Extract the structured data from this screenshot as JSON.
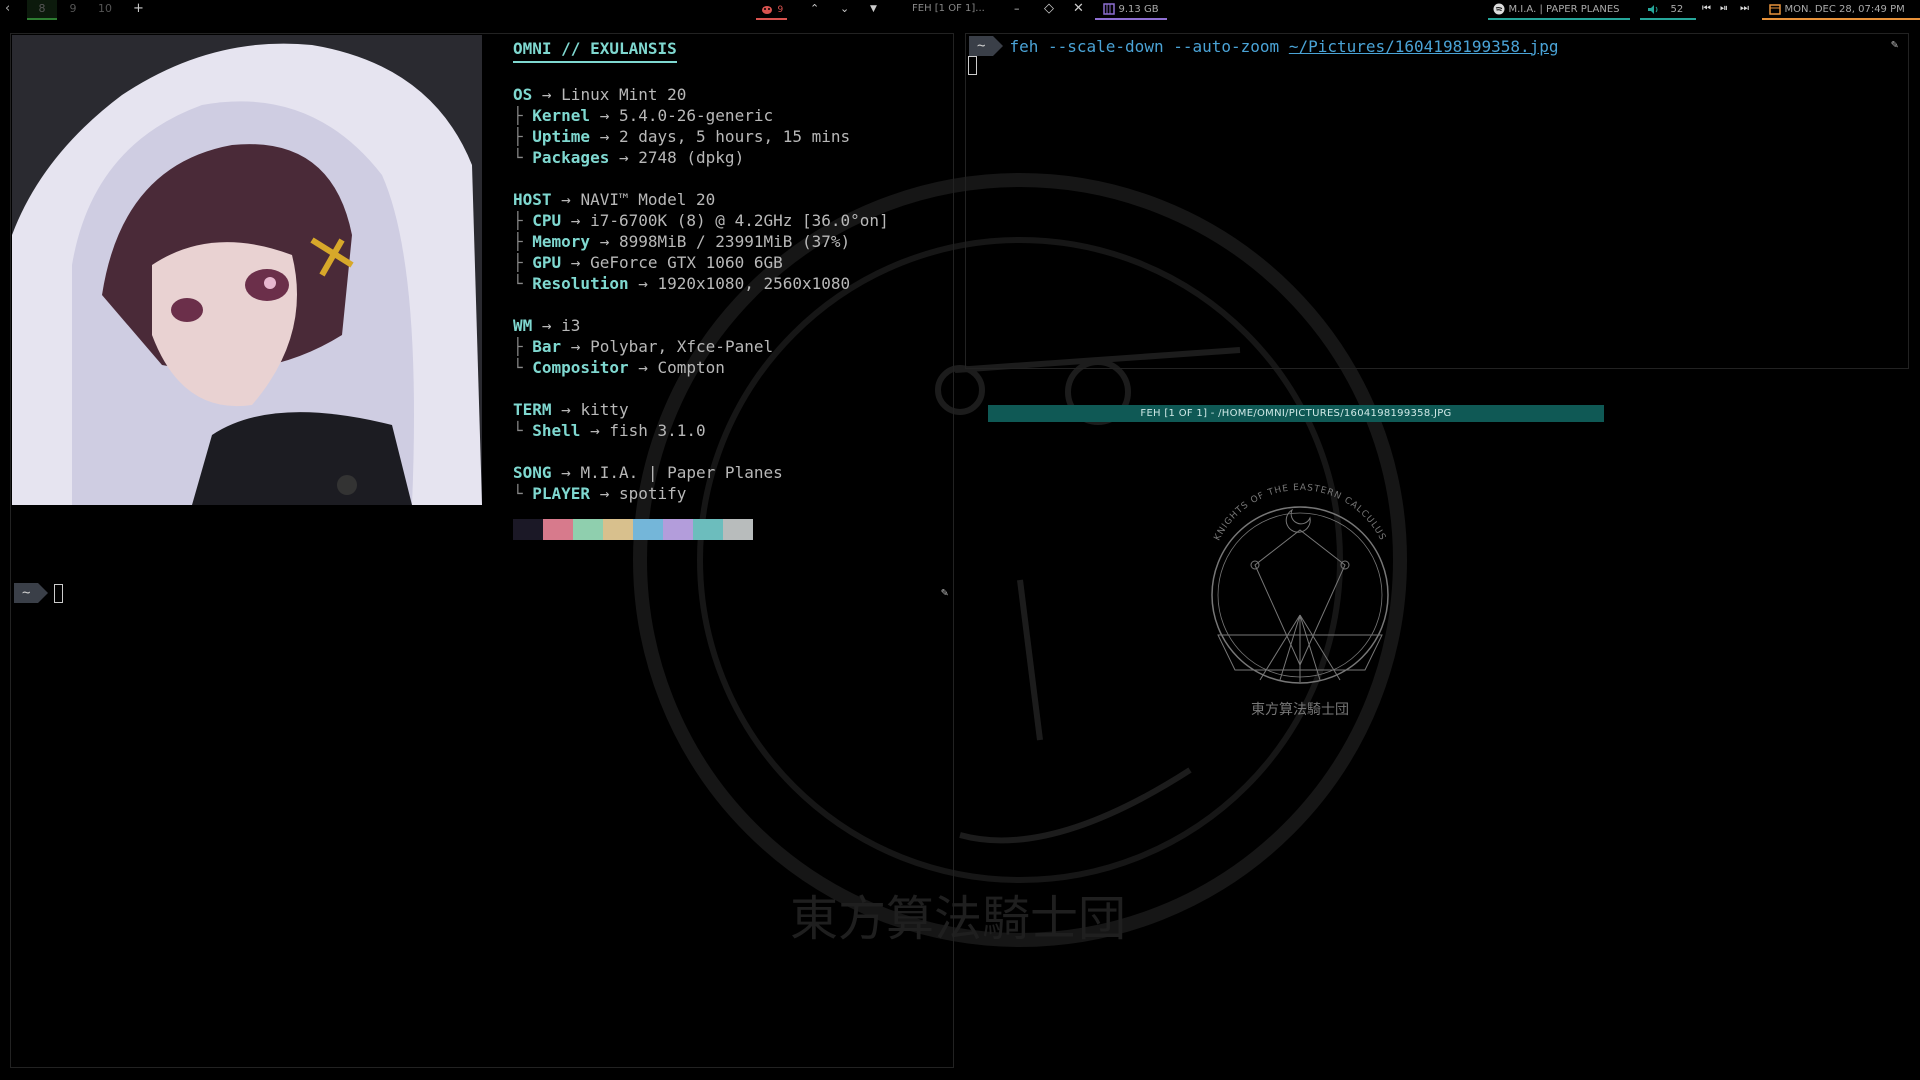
{
  "topbar": {
    "prev_arrow": "‹",
    "workspaces": [
      "8",
      "9",
      "10"
    ],
    "add": "+",
    "tasks_count": "9",
    "window_title": "FEH [1 OF 1]...",
    "storage": "9.13 GB",
    "now_playing": "M.I.A. | PAPER PLANES",
    "volume": "52",
    "datetime": "MON. DEC 28, 07:49 PM",
    "colors": {
      "accent_green": "#2e7d32",
      "accent_red": "#d9534f",
      "accent_purple": "#8e6fd1",
      "accent_teal": "#26a69a",
      "accent_orange": "#e8923a"
    }
  },
  "fetch": {
    "title": "OMNI // EXULANSIS",
    "groups": [
      {
        "label": "OS",
        "value": "Linux Mint 20",
        "items": [
          {
            "label": "Kernel",
            "value": "5.4.0-26-generic"
          },
          {
            "label": "Uptime",
            "value": "2 days, 5 hours, 15 mins"
          },
          {
            "label": "Packages",
            "value": "2748 (dpkg)"
          }
        ]
      },
      {
        "label": "HOST",
        "value": "NAVI™ Model 20",
        "items": [
          {
            "label": "CPU",
            "value": "i7-6700K (8) @ 4.2GHz [36.0°on]"
          },
          {
            "label": "Memory",
            "value": "8998MiB / 23991MiB (37%)"
          },
          {
            "label": "GPU",
            "value": "GeForce GTX 1060 6GB"
          },
          {
            "label": "Resolution",
            "value": "1920x1080, 2560x1080"
          }
        ]
      },
      {
        "label": "WM",
        "value": "i3",
        "items": [
          {
            "label": "Bar",
            "value": "Polybar, Xfce-Panel"
          },
          {
            "label": "Compositor",
            "value": "Compton"
          }
        ]
      },
      {
        "label": "TERM",
        "value": "kitty",
        "items": [
          {
            "label": "Shell",
            "value": "fish 3.1.0"
          }
        ]
      },
      {
        "label": "SONG",
        "value": "M.I.A. | Paper Planes",
        "items": [
          {
            "label": "PLAYER",
            "value": "spotify"
          }
        ]
      }
    ],
    "palette": [
      "#1b1826",
      "#d77a8c",
      "#8fcfae",
      "#d8c08d",
      "#74b6d9",
      "#b39ddb",
      "#6cbdbd",
      "#b8bcbc"
    ]
  },
  "left_terminal": {
    "prompt": "~"
  },
  "right_terminal": {
    "prompt": "~",
    "command": "feh",
    "args": "--scale-down --auto-zoom",
    "path": "~/Pictures/1604198199358.jpg"
  },
  "feh": {
    "title": "FEH [1 OF 1] - /HOME/OMNI/PICTURES/1604198199358.JPG",
    "image_text_arc": "KNIGHTS OF THE EASTERN CALCULUS",
    "image_text_kanji": "東方算法騎士団"
  },
  "wallpaper": {
    "kanji": "東方算法騎士団"
  }
}
